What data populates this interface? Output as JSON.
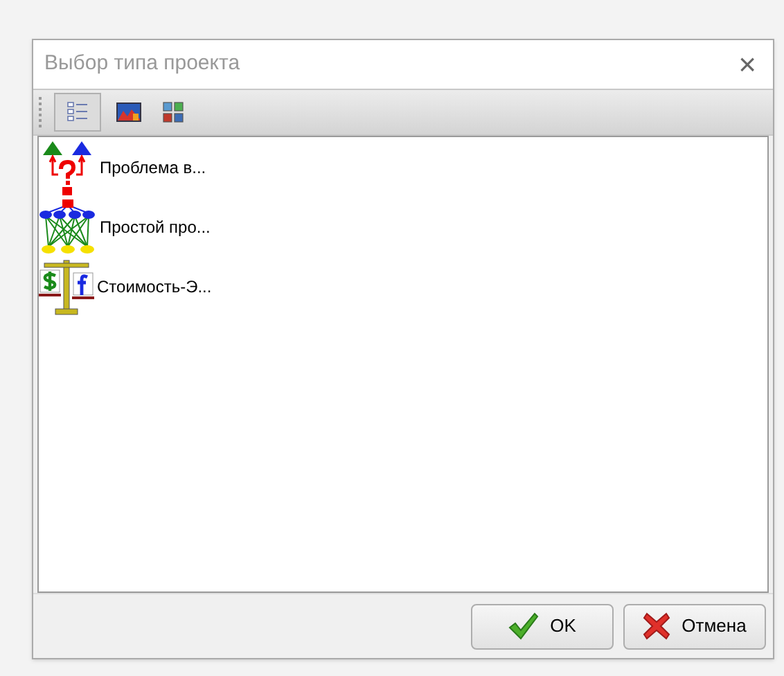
{
  "window": {
    "title": "Выбор типа проекта",
    "close": "×"
  },
  "toolbar": {
    "views": [
      {
        "kind": "list",
        "selected": true
      },
      {
        "kind": "picture",
        "selected": false
      },
      {
        "kind": "tiles",
        "selected": false
      }
    ]
  },
  "items": [
    {
      "kind": "problem",
      "label": "Проблема в..."
    },
    {
      "kind": "network",
      "label": "Простой про..."
    },
    {
      "kind": "scales",
      "label": "Стоимость-Э..."
    }
  ],
  "buttons": [
    {
      "kind": "ok",
      "label": "OK"
    },
    {
      "kind": "cancel",
      "label": "Отмена"
    }
  ]
}
